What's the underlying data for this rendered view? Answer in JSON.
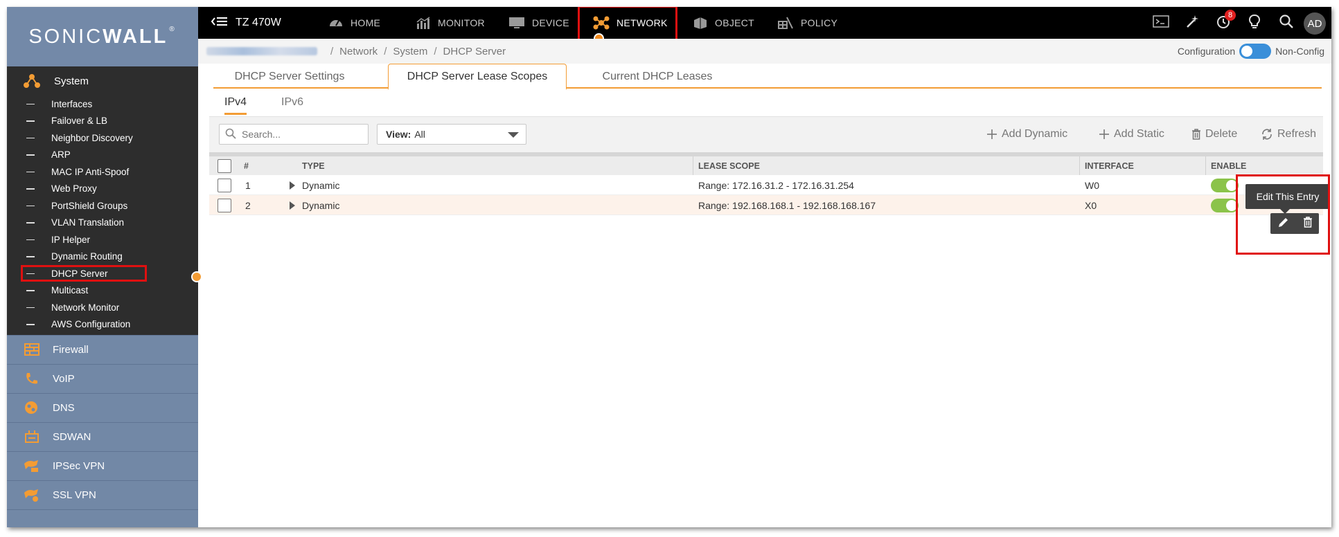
{
  "brand": {
    "logo_prefix": "SONIC",
    "logo_suffix": "WALL",
    "logo_mark": "®"
  },
  "topbar": {
    "device_name": "TZ 470W",
    "nav": [
      {
        "label": "HOME",
        "icon": "dashboard-icon"
      },
      {
        "label": "MONITOR",
        "icon": "monitor-chart-icon"
      },
      {
        "label": "DEVICE",
        "icon": "device-screen-icon"
      },
      {
        "label": "NETWORK",
        "icon": "network-nodes-icon",
        "active": true
      },
      {
        "label": "OBJECT",
        "icon": "object-cube-icon"
      },
      {
        "label": "POLICY",
        "icon": "policy-icon"
      }
    ],
    "notification_count": "8",
    "avatar_initials": "AD"
  },
  "breadcrumb": {
    "items": [
      "Network",
      "System",
      "DHCP Server"
    ]
  },
  "mode": {
    "left_label": "Configuration",
    "right_label": "Non-Config"
  },
  "sidebar": {
    "section_title": "System",
    "items": [
      {
        "label": "Interfaces"
      },
      {
        "label": "Failover & LB"
      },
      {
        "label": "Neighbor Discovery"
      },
      {
        "label": "ARP"
      },
      {
        "label": "MAC IP Anti-Spoof"
      },
      {
        "label": "Web Proxy"
      },
      {
        "label": "PortShield Groups"
      },
      {
        "label": "VLAN Translation"
      },
      {
        "label": "IP Helper"
      },
      {
        "label": "Dynamic Routing"
      },
      {
        "label": "DHCP Server",
        "active": true
      },
      {
        "label": "Multicast"
      },
      {
        "label": "Network Monitor"
      },
      {
        "label": "AWS Configuration"
      }
    ],
    "sections": [
      {
        "label": "Firewall",
        "icon": "firewall-icon"
      },
      {
        "label": "VoIP",
        "icon": "phone-icon"
      },
      {
        "label": "DNS",
        "icon": "dns-icon"
      },
      {
        "label": "SDWAN",
        "icon": "sdwan-icon"
      },
      {
        "label": "IPSec VPN",
        "icon": "ipsec-vpn-icon"
      },
      {
        "label": "SSL VPN",
        "icon": "ssl-vpn-icon"
      }
    ]
  },
  "tabs": [
    {
      "label": "DHCP Server Settings"
    },
    {
      "label": "DHCP Server Lease Scopes",
      "active": true
    },
    {
      "label": "Current DHCP Leases"
    }
  ],
  "subtabs": [
    {
      "label": "IPv4",
      "active": true
    },
    {
      "label": "IPv6"
    }
  ],
  "toolbar": {
    "search_placeholder": "Search...",
    "view_label": "View:",
    "view_value": "All",
    "add_dynamic": "Add Dynamic",
    "add_static": "Add Static",
    "delete": "Delete",
    "refresh": "Refresh"
  },
  "table": {
    "columns": [
      "#",
      "TYPE",
      "LEASE SCOPE",
      "INTERFACE",
      "ENABLE"
    ],
    "rows": [
      {
        "num": "1",
        "type": "Dynamic",
        "scope": "Range: 172.16.31.2 - 172.16.31.254",
        "iface": "W0",
        "enabled": true
      },
      {
        "num": "2",
        "type": "Dynamic",
        "scope": "Range: 192.168.168.1 - 192.168.168.167",
        "iface": "X0",
        "enabled": true
      }
    ]
  },
  "tooltip": "Edit This Entry",
  "colors": {
    "accent": "#f39c34",
    "highlight": "#e01010",
    "sidebar": "#7288a6",
    "toggle_on": "#8bc34a"
  }
}
